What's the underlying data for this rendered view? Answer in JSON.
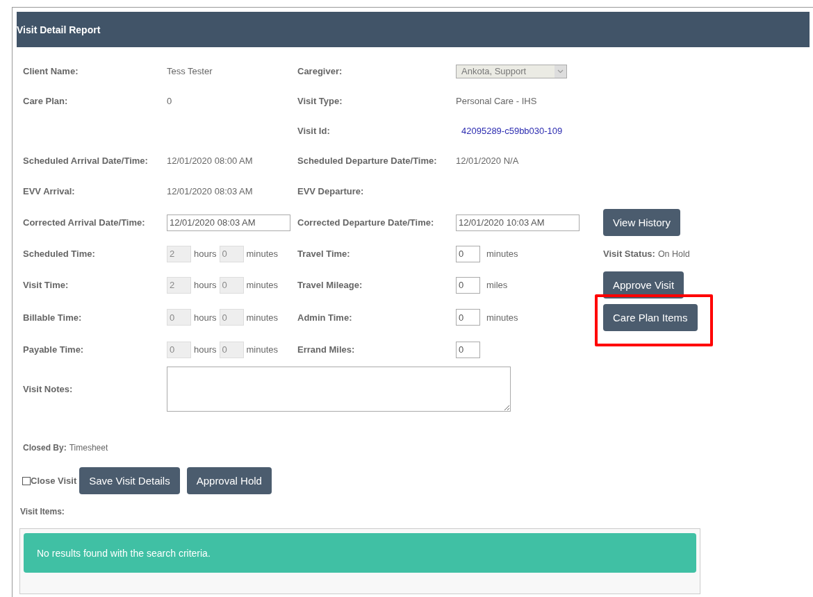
{
  "header": {
    "title": "Visit Detail Report"
  },
  "rows": [
    {
      "left": {
        "label": "Client Name:",
        "value": {
          "kind": "text",
          "text": "Tess Tester"
        }
      },
      "right": {
        "label": "Caregiver:",
        "value": {
          "kind": "select",
          "text": "Ankota, Support",
          "disabled": true
        }
      }
    },
    {
      "left": {
        "label": "Care Plan:",
        "value": {
          "kind": "text",
          "text": "0"
        }
      },
      "right": {
        "label": "Visit Type:",
        "value": {
          "kind": "text",
          "text": "Personal Care - IHS"
        }
      }
    },
    {
      "right": {
        "label": "Visit Id:",
        "value": {
          "kind": "link",
          "text": "42095289-c59bb030-109"
        }
      }
    },
    {
      "left": {
        "label": "Scheduled Arrival Date/Time:",
        "value": {
          "kind": "text",
          "text": "12/01/2020 08:00 AM"
        }
      },
      "right": {
        "label": "Scheduled Departure Date/Time:",
        "value": {
          "kind": "text",
          "text": "12/01/2020 N/A"
        }
      }
    },
    {
      "left": {
        "label": "EVV Arrival:",
        "value": {
          "kind": "text",
          "text": "12/01/2020 08:03 AM"
        }
      },
      "right": {
        "label": "EVV Departure:"
      }
    },
    {
      "left": {
        "label": "Corrected Arrival Date/Time:",
        "value": {
          "kind": "input",
          "text": "12/01/2020 08:03 AM"
        }
      },
      "right": {
        "label": "Corrected Departure Date/Time:",
        "value": {
          "kind": "input",
          "text": "12/01/2020 10:03 AM"
        }
      },
      "side": {
        "kind": "button",
        "label": "View History",
        "highlighted": false
      }
    },
    {
      "left": {
        "label": "Scheduled Time:",
        "value": {
          "kind": "duration",
          "hours": "2",
          "hours_unit": "hours",
          "minutes": "0",
          "minutes_unit": "minutes",
          "disabled": true
        }
      },
      "right": {
        "label": "Travel Time:",
        "value": {
          "kind": "unit-input",
          "text": "0",
          "unit": "minutes"
        }
      },
      "side": {
        "kind": "status",
        "label": "Visit Status:",
        "text": "On Hold"
      }
    },
    {
      "left": {
        "label": "Visit Time:",
        "value": {
          "kind": "duration",
          "hours": "2",
          "hours_unit": "hours",
          "minutes": "0",
          "minutes_unit": "minutes",
          "disabled": true
        }
      },
      "right": {
        "label": "Travel Mileage:",
        "value": {
          "kind": "unit-input",
          "text": "0",
          "unit": "miles"
        }
      },
      "side": {
        "kind": "button",
        "label": "Approve Visit",
        "highlighted": false
      }
    },
    {
      "left": {
        "label": "Billable Time:",
        "value": {
          "kind": "duration",
          "hours": "0",
          "hours_unit": "hours",
          "minutes": "0",
          "minutes_unit": "minutes",
          "disabled": true
        }
      },
      "right": {
        "label": "Admin Time:",
        "value": {
          "kind": "unit-input",
          "text": "0",
          "unit": "minutes"
        }
      },
      "side": {
        "kind": "button",
        "label": "Care Plan Items",
        "highlighted": true
      }
    },
    {
      "left": {
        "label": "Payable Time:",
        "value": {
          "kind": "duration",
          "hours": "0",
          "hours_unit": "hours",
          "minutes": "0",
          "minutes_unit": "minutes",
          "disabled": true
        }
      },
      "right": {
        "label": "Errand Miles:",
        "value": {
          "kind": "unit-input",
          "text": "0"
        }
      }
    }
  ],
  "notes": {
    "label": "Visit Notes:"
  },
  "closed_by": {
    "label": "Closed By:",
    "value": "Timesheet"
  },
  "actions": {
    "close_visit": {
      "label": "Close Visit",
      "checked": false
    },
    "buttons": [
      "Save Visit Details",
      "Approval Hold"
    ]
  },
  "visit_items": {
    "label": "Visit Items:",
    "message": "No results found with the search criteria."
  }
}
